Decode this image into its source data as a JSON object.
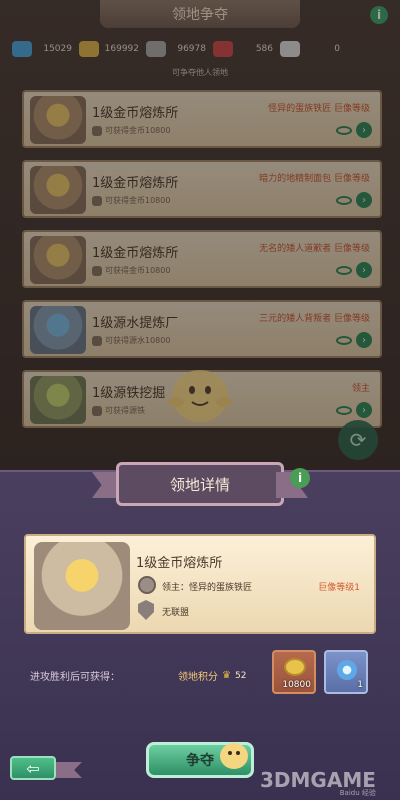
{
  "header": {
    "title": "领地争夺"
  },
  "resources": [
    {
      "icon": "water-drop-icon",
      "value": "15029",
      "color": "#4aa3d9"
    },
    {
      "icon": "gold-coin-icon",
      "value": "169992",
      "color": "#d9b24a"
    },
    {
      "icon": "iron-ore-icon",
      "value": "96978",
      "color": "#a9a9a9"
    },
    {
      "icon": "dumbbell-icon",
      "value": "586",
      "color": "#c84a4a"
    },
    {
      "icon": "scroll-icon",
      "value": "0",
      "color": "#d8d8d8"
    }
  ],
  "subtitle": "可争夺他人领地",
  "territories": [
    {
      "name": "1级金币熔炼所",
      "reward": "可获得金币10800",
      "owner": "怪异的蛋族铁匠  巨像等级",
      "thumb": "gold"
    },
    {
      "name": "1级金币熔炼所",
      "reward": "可获得金币10800",
      "owner": "暗力的地精制面包  巨像等级",
      "thumb": "gold"
    },
    {
      "name": "1级金币熔炼所",
      "reward": "可获得金币10800",
      "owner": "无名的矮人道歉者  巨像等级",
      "thumb": "gold"
    },
    {
      "name": "1级源水提炼厂",
      "reward": "可获得源水10800",
      "owner": "三元的矮人背叛者  巨像等级",
      "thumb": "blue"
    },
    {
      "name": "1级源铁挖掘",
      "reward": "可获得源铁",
      "owner": "领主",
      "thumb": "green"
    }
  ],
  "panel": {
    "title": "领地详情",
    "name": "1级金币熔炼所",
    "lord": "领主：怪异的蛋族铁匠",
    "rank": "巨像等级1",
    "alliance": "无联盟",
    "rewards_label": "进攻胜利后可获得：",
    "points_label": "领地积分",
    "points_value": "52",
    "items": [
      {
        "icon": "gold-coin-icon",
        "qty": "10800"
      },
      {
        "icon": "crystal-orb-icon",
        "qty": "1"
      }
    ],
    "attack_label": "争夺",
    "back_icon": "back-arrow-icon"
  },
  "watermark": {
    "main": "3DMGAME",
    "sub": "Baidu 经验"
  }
}
